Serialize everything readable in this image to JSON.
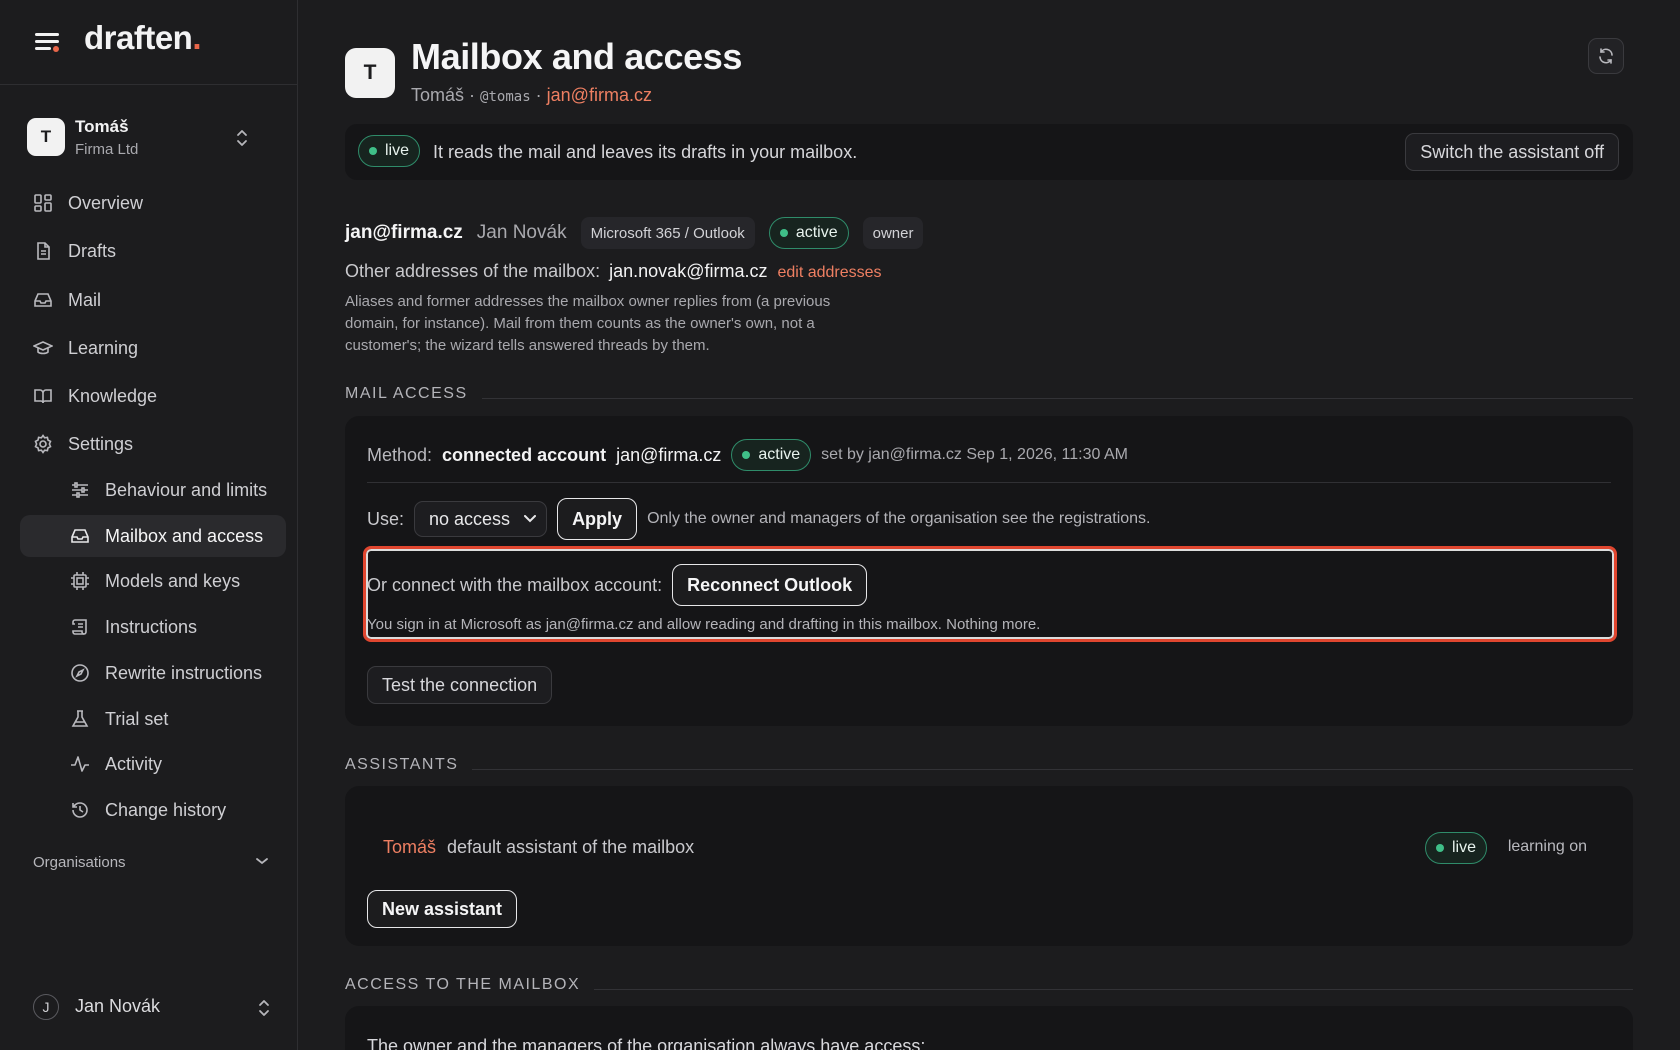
{
  "sidebar": {
    "logo": "draften",
    "logo_dot": ".",
    "org": {
      "avatar": "T",
      "name": "Tomáš",
      "sub": "Firma Ltd"
    },
    "nav": [
      {
        "label": "Overview",
        "icon": "grid-icon"
      },
      {
        "label": "Drafts",
        "icon": "document-icon"
      },
      {
        "label": "Mail",
        "icon": "inbox-icon"
      },
      {
        "label": "Learning",
        "icon": "graduation-cap-icon"
      },
      {
        "label": "Knowledge",
        "icon": "book-icon"
      },
      {
        "label": "Settings",
        "icon": "gear-icon"
      }
    ],
    "settings_sub": [
      {
        "label": "Behaviour and limits",
        "icon": "sliders-icon"
      },
      {
        "label": "Mailbox and access",
        "icon": "inbox-icon",
        "active": true
      },
      {
        "label": "Models and keys",
        "icon": "chip-icon"
      },
      {
        "label": "Instructions",
        "icon": "scroll-icon"
      },
      {
        "label": "Rewrite instructions",
        "icon": "compass-icon"
      },
      {
        "label": "Trial set",
        "icon": "flask-icon"
      },
      {
        "label": "Activity",
        "icon": "activity-icon"
      },
      {
        "label": "Change history",
        "icon": "history-icon"
      }
    ],
    "organisations_label": "Organisations",
    "user": {
      "avatar": "J",
      "name": "Jan Novák"
    }
  },
  "header": {
    "avatar": "T",
    "title": "Mailbox and access",
    "sub_name": "Tomáš",
    "sub_sep": "·",
    "sub_handle": "@tomas",
    "sub_email": "jan@firma.cz"
  },
  "status": {
    "pill": "live",
    "text": "It reads the mail and leaves its drafts in your mailbox.",
    "switch_off": "Switch the assistant off"
  },
  "mailbox": {
    "email": "jan@firma.cz",
    "owner_name": "Jan Novák",
    "provider": "Microsoft 365 / Outlook",
    "state": "active",
    "role": "owner",
    "other_label": "Other addresses of the mailbox:",
    "other_value": "jan.novak@firma.cz",
    "edit_link": "edit addresses",
    "help": "Aliases and former addresses the mailbox owner replies from (a previous domain, for instance). Mail from them counts as the owner's own, not a customer's; the wizard tells answered threads by them."
  },
  "mail_access": {
    "heading": "MAIL ACCESS",
    "method_label": "Method:",
    "method_value": "connected account",
    "method_email": "jan@firma.cz",
    "method_state": "active",
    "method_set": "set by jan@firma.cz Sep 1, 2026, 11:30 AM",
    "use_label": "Use:",
    "use_selected": "no access",
    "apply": "Apply",
    "use_note": "Only the owner and managers of the organisation see the registrations.",
    "connect_label": "Or connect with the mailbox account:",
    "reconnect": "Reconnect Outlook",
    "connect_note": "You sign in at Microsoft as jan@firma.cz and allow reading and drafting in this mailbox. Nothing more.",
    "test": "Test the connection"
  },
  "assistants": {
    "heading": "ASSISTANTS",
    "name": "Tomáš",
    "desc": "default assistant of the mailbox",
    "state": "live",
    "learning": "learning on",
    "new_button": "New assistant"
  },
  "access": {
    "heading": "ACCESS TO THE MAILBOX",
    "text": "The owner and the managers of the organisation always have access;"
  },
  "colors": {
    "accent": "#ee7f62",
    "live_green": "#3fbf88",
    "highlight": "#e0462f"
  }
}
